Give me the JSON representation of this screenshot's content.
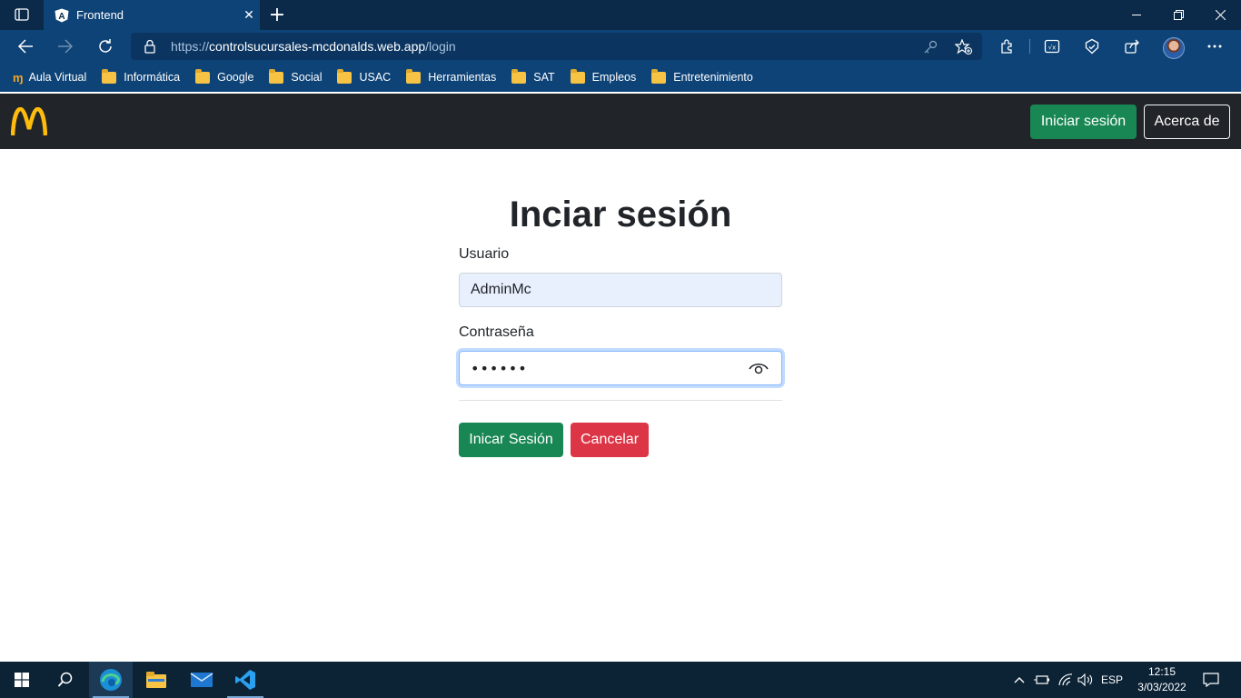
{
  "browser": {
    "tab": {
      "title": "Frontend"
    },
    "address": {
      "scheme": "https://",
      "host": "controlsucursales-mcdonalds.web.app",
      "path": "/login"
    },
    "bookmarks": [
      {
        "label": "Aula Virtual",
        "icon": "moodle-icon"
      },
      {
        "label": "Informática",
        "icon": "folder-icon"
      },
      {
        "label": "Google",
        "icon": "folder-icon"
      },
      {
        "label": "Social",
        "icon": "folder-icon"
      },
      {
        "label": "USAC",
        "icon": "folder-icon"
      },
      {
        "label": "Herramientas",
        "icon": "folder-icon"
      },
      {
        "label": "SAT",
        "icon": "folder-icon"
      },
      {
        "label": "Empleos",
        "icon": "folder-icon"
      },
      {
        "label": "Entretenimiento",
        "icon": "folder-icon"
      }
    ]
  },
  "navbar": {
    "logo": "mcdonalds-arches-logo",
    "login_label": "Iniciar sesión",
    "about_label": "Acerca de"
  },
  "form": {
    "title": "Inciar sesión",
    "user_label": "Usuario",
    "user_value": "AdminMc",
    "password_label": "Contraseña",
    "password_value": "••••••",
    "submit_label": "Inicar Sesión",
    "cancel_label": "Cancelar"
  },
  "taskbar": {
    "language": "ESP",
    "time": "12:15",
    "date": "3/03/2022"
  },
  "colors": {
    "browser_frame": "#0e4377",
    "navbar_bg": "#212529",
    "success": "#198754",
    "danger": "#dc3545",
    "logo": "#ffbc0d"
  }
}
